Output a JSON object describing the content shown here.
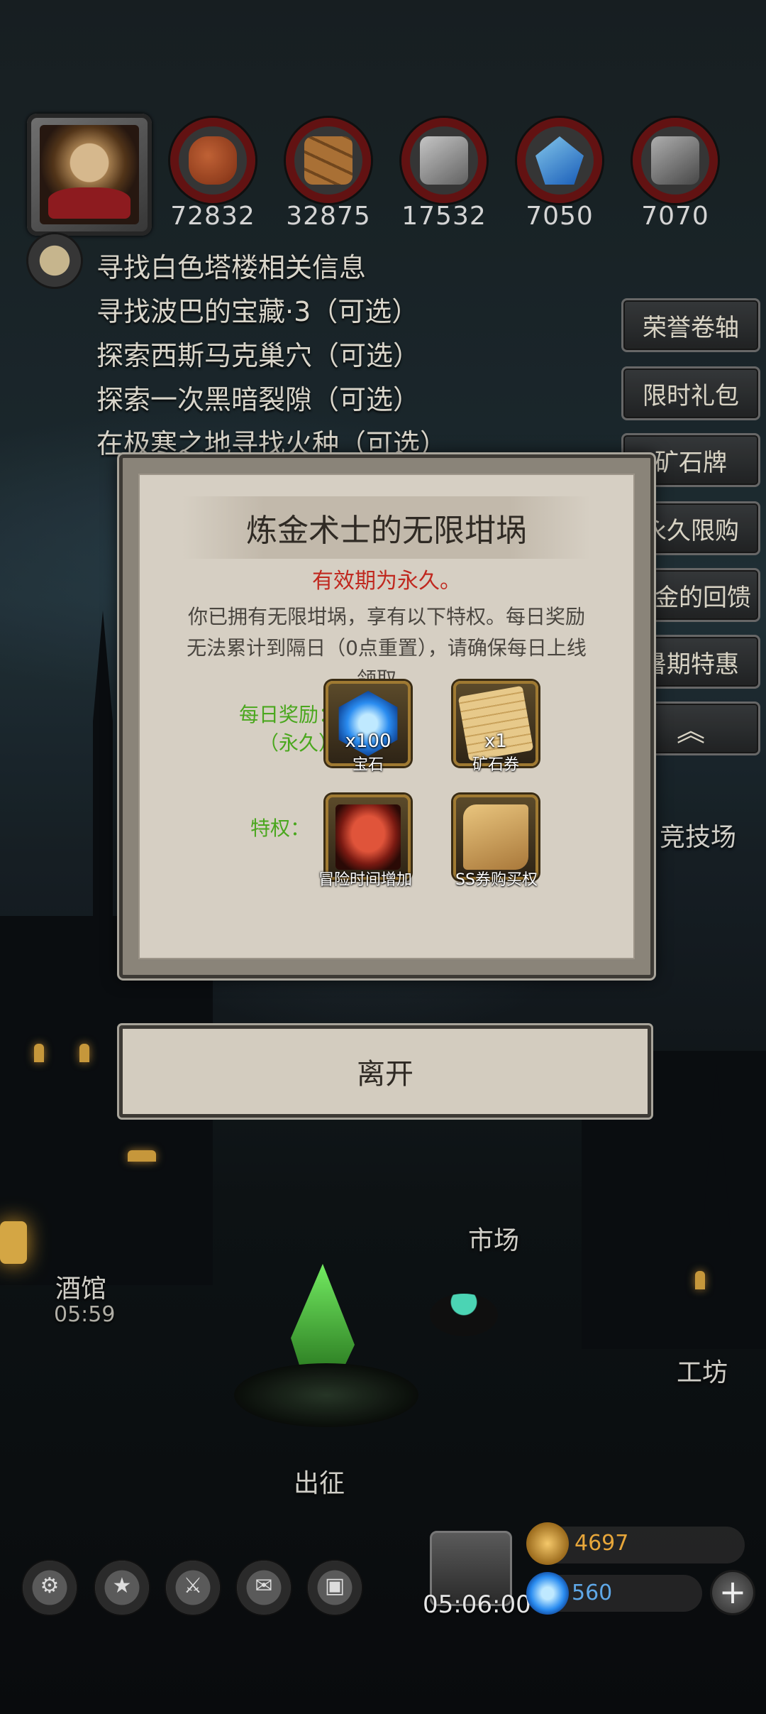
{
  "resources": [
    {
      "icon": "meat-icon",
      "value": "72832"
    },
    {
      "icon": "wood-icon",
      "value": "32875"
    },
    {
      "icon": "iron-icon",
      "value": "17532"
    },
    {
      "icon": "crystal-icon",
      "value": "7050"
    },
    {
      "icon": "stone-icon",
      "value": "7070"
    }
  ],
  "quests": [
    "寻找白色塔楼相关信息",
    "寻找波巴的宝藏·3（可选）",
    "探索西斯马克巢穴（可选）",
    "探索一次黑暗裂隙（可选）",
    "在极寒之地寻找火种（可选）"
  ],
  "right_menu": [
    "荣誉卷轴",
    "限时礼包",
    "矿石牌",
    "永久限购",
    "黄金的回馈",
    "暑期特惠",
    "︽"
  ],
  "dialog": {
    "title": "炼金术士的无限坩埚",
    "validity": "有效期为永久。",
    "description": "你已拥有无限坩埚，享有以下特权。每日奖励无法累计到隔日（0点重置），请确保每日上线领取。",
    "daily_label": "每日奖励：",
    "daily_sub": "（永久）",
    "privilege_label": "特权：",
    "rewards": [
      {
        "icon": "gem-icon",
        "qty": "x100",
        "name": "宝石"
      },
      {
        "icon": "ore-coupon-icon",
        "qty": "x1",
        "name": "矿石券"
      }
    ],
    "privileges": [
      {
        "icon": "adventure-time-icon",
        "name": "冒险时间增加"
      },
      {
        "icon": "ss-coupon-icon",
        "name": "SS券购买权"
      }
    ],
    "leave_label": "离开"
  },
  "town": {
    "arena": "竞技场",
    "market": "市场",
    "tavern": "酒馆",
    "tavern_timer": "05:59",
    "workshop": "工坊",
    "expedition": "出征"
  },
  "bottom": {
    "icons": [
      "settings-icon",
      "achievement-icon",
      "hero-icon",
      "mail-icon",
      "inventory-icon"
    ],
    "gift_timer": "05:06:00",
    "gold": "4697",
    "gems": "560"
  },
  "colors": {
    "validity_red": "#c0281f",
    "label_green": "#4aa71e",
    "gold_text": "#e7a63a",
    "gem_text": "#5fa8e8"
  }
}
